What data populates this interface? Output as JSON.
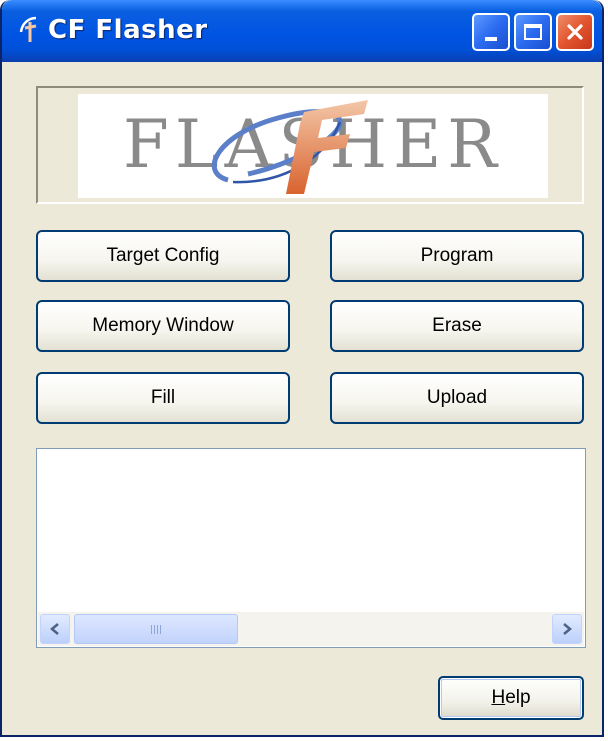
{
  "window": {
    "title": "CF Flasher",
    "icon": "cf-flasher-app-icon",
    "controls": [
      "minimize-icon",
      "maximize-icon",
      "close-icon"
    ]
  },
  "logo": {
    "text": "FLASHER",
    "emblem": "cf-swoosh-logo"
  },
  "buttons": {
    "target_config": "Target Config",
    "program": "Program",
    "memory_window": "Memory Window",
    "erase": "Erase",
    "fill": "Fill",
    "upload": "Upload"
  },
  "output": {
    "text": "",
    "scroll_left_icon": "chevron-left-icon",
    "scroll_right_icon": "chevron-right-icon"
  },
  "help": {
    "label_accel": "H",
    "label_rest": "elp"
  },
  "colors": {
    "titlebar": "#0054e3",
    "window_bg": "#ece9d8",
    "button_border": "#003c74",
    "close_button": "#e2552e"
  }
}
